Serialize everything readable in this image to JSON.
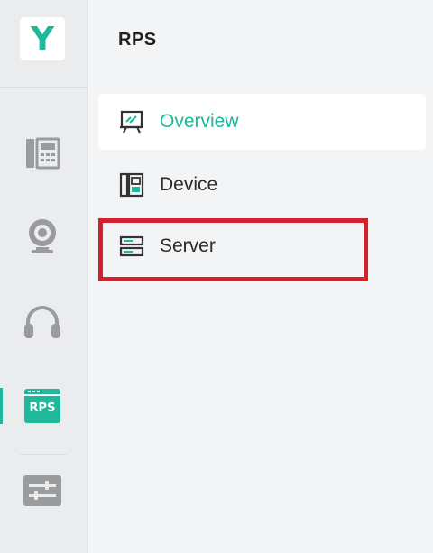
{
  "rail": {
    "logo_letter": "Y",
    "items": [
      {
        "name": "phone",
        "icon": "desk-phone-icon"
      },
      {
        "name": "webcam",
        "icon": "webcam-icon"
      },
      {
        "name": "headset",
        "icon": "headset-icon"
      },
      {
        "name": "rps",
        "icon": "rps-icon",
        "badge_text": "RPS",
        "active": true
      },
      {
        "name": "settings",
        "icon": "sliders-icon"
      }
    ],
    "accent_color": "#1fb89a"
  },
  "panel": {
    "title": "RPS",
    "nav": [
      {
        "label": "Overview",
        "icon": "presentation-board-icon",
        "active": true
      },
      {
        "label": "Device",
        "icon": "device-icon",
        "active": false
      },
      {
        "label": "Server",
        "icon": "server-icon",
        "active": false,
        "highlighted": true
      }
    ]
  },
  "highlight_color": "#d4202a"
}
